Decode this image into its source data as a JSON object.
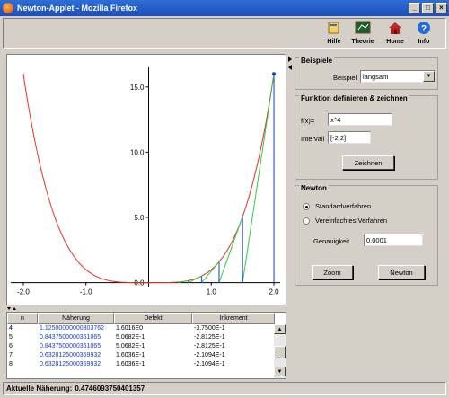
{
  "window": {
    "title": "Newton-Applet - Mozilla Firefox"
  },
  "toolbar": {
    "items": [
      {
        "label": "Hilfe",
        "icon": "help-book-icon"
      },
      {
        "label": "Theorie",
        "icon": "blackboard-icon"
      },
      {
        "label": "Home",
        "icon": "house-icon"
      },
      {
        "label": "Info",
        "icon": "info-icon"
      }
    ]
  },
  "chart_data": {
    "type": "line",
    "function": "x^4",
    "xlim": [
      -2.2,
      2.1
    ],
    "ylim": [
      -0.3,
      16.5
    ],
    "xticks": [
      -2.0,
      -1.0,
      0.0,
      1.0,
      2.0
    ],
    "xtick_labels": [
      "-2.0",
      "-1.0",
      "0.0",
      "1.0",
      "2.0"
    ],
    "yticks": [
      0.0,
      5.0,
      10.0,
      15.0
    ],
    "ytick_labels": [
      "0.0",
      "5.0",
      "10.0",
      "15.0"
    ],
    "newton_start": 2.0,
    "iterates": [
      2.0,
      1.5,
      1.125,
      0.84375,
      0.6328125,
      0.474609375
    ],
    "colors": {
      "curve": "#e8302a",
      "tangent": "#2ecc40",
      "vertical": "#1a3cc8"
    }
  },
  "beispiele": {
    "legend": "Beispiele",
    "label": "Beispiel",
    "selected": "langsam"
  },
  "funktion": {
    "legend": "Funktion definieren & zeichnen",
    "f_label": "f(x)=",
    "f_value": "x^4",
    "interval_label": "Intervall",
    "interval_value": "[-2,2]",
    "draw_button": "Zeichnen"
  },
  "newton": {
    "legend": "Newton",
    "radio1": "Standardverfahren",
    "radio2": "Vereinfachtes Verfahren",
    "accuracy_label": "Genauigkeit",
    "accuracy_value": "0.0001",
    "zoom_button": "Zoom",
    "newton_button": "Newton"
  },
  "table": {
    "headers": [
      "n",
      "Näherung",
      "Defekt",
      "Inkrement"
    ],
    "rows": [
      [
        "4",
        "1.12500000000303762",
        "1.6016E0",
        "-3.7500E-1"
      ],
      [
        "5",
        "0.8437500000361065",
        "5.0682E-1",
        "-2.8125E-1"
      ],
      [
        "6",
        "0.8437500000361065",
        "5.0682E-1",
        "-2.8125E-1"
      ],
      [
        "7",
        "0.6328125000359932",
        "1.6036E-1",
        "-2.1094E-1"
      ],
      [
        "8",
        "0.6328125000359932",
        "1.6036E-1",
        "-2.1094E-1"
      ]
    ]
  },
  "status": {
    "label": "Aktuelle Näherung:",
    "value": "0.4746093750401357"
  }
}
